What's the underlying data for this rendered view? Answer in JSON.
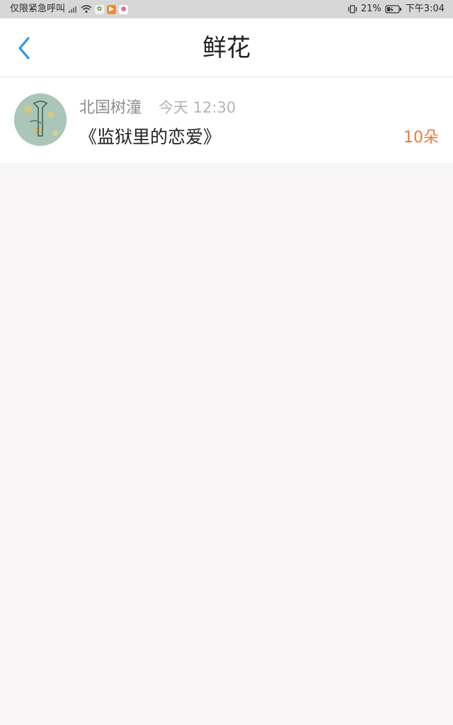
{
  "status_bar": {
    "carrier_text": "仅限紧急呼叫",
    "battery_percent": "21%",
    "time": "下午3:04",
    "icons": [
      "signal-icon",
      "wifi-icon",
      "app-notification-icon",
      "play-icon",
      "chat-icon",
      "vibrate-icon",
      "battery-icon"
    ]
  },
  "header": {
    "title": "鲜花",
    "back_icon": "chevron-left-icon"
  },
  "list": {
    "items": [
      {
        "sender": "北国树潼",
        "time": "今天 12:30",
        "story": "《监狱里的恋爱》",
        "count": "10朵"
      }
    ]
  },
  "colors": {
    "accent": "#2a9bd8",
    "count": "#ec7a38",
    "background": "#f8f6f7",
    "status_bar_bg": "#d7d7d7"
  }
}
